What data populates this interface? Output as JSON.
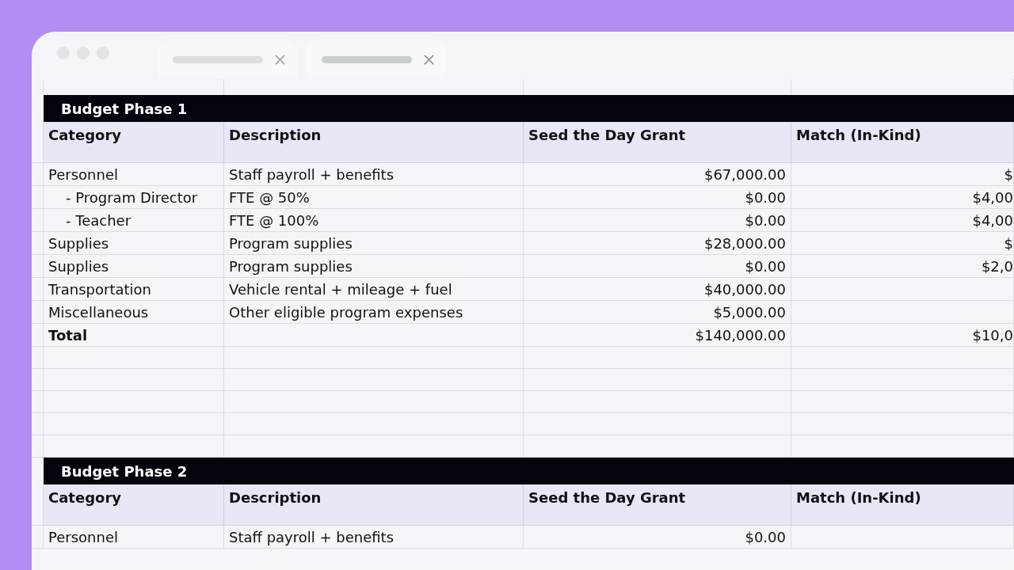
{
  "sections": [
    {
      "title": "Budget Phase 1",
      "columns": [
        "Category",
        "Description",
        "Seed the Day Grant",
        "Match (In-Kind)"
      ],
      "rows": [
        {
          "kind": "item",
          "cells": [
            "Personnel",
            "Staff payroll + benefits",
            "$67,000.00",
            "$"
          ],
          "children": [
            {
              "kind": "item",
              "cells": [
                "- Program Director",
                "FTE @ 50%",
                "$0.00",
                "$4,00"
              ]
            },
            {
              "kind": "item",
              "cells": [
                "- Teacher",
                "FTE @ 100%",
                "$0.00",
                "$4,00"
              ]
            }
          ]
        },
        {
          "kind": "item",
          "cells": [
            "Supplies",
            "Program supplies",
            "$28,000.00",
            "$"
          ]
        },
        {
          "kind": "item",
          "cells": [
            "Supplies",
            "Program supplies",
            "$0.00",
            "$2,0"
          ]
        },
        {
          "kind": "item",
          "cells": [
            "Transportation",
            "Vehicle rental + mileage + fuel",
            "$40,000.00",
            ""
          ]
        },
        {
          "kind": "item",
          "cells": [
            "Miscellaneous",
            "Other eligible program expenses",
            "$5,000.00",
            ""
          ]
        },
        {
          "kind": "total",
          "cells": [
            "Total",
            "",
            "$140,000.00",
            "$10,0"
          ]
        }
      ]
    },
    {
      "title": "Budget Phase 2",
      "columns": [
        "Category",
        "Description",
        "Seed the Day Grant",
        "Match (In-Kind)"
      ],
      "rows": [
        {
          "kind": "item",
          "cells": [
            "Personnel",
            "Staff payroll + benefits",
            "$0.00",
            ""
          ]
        }
      ]
    }
  ]
}
